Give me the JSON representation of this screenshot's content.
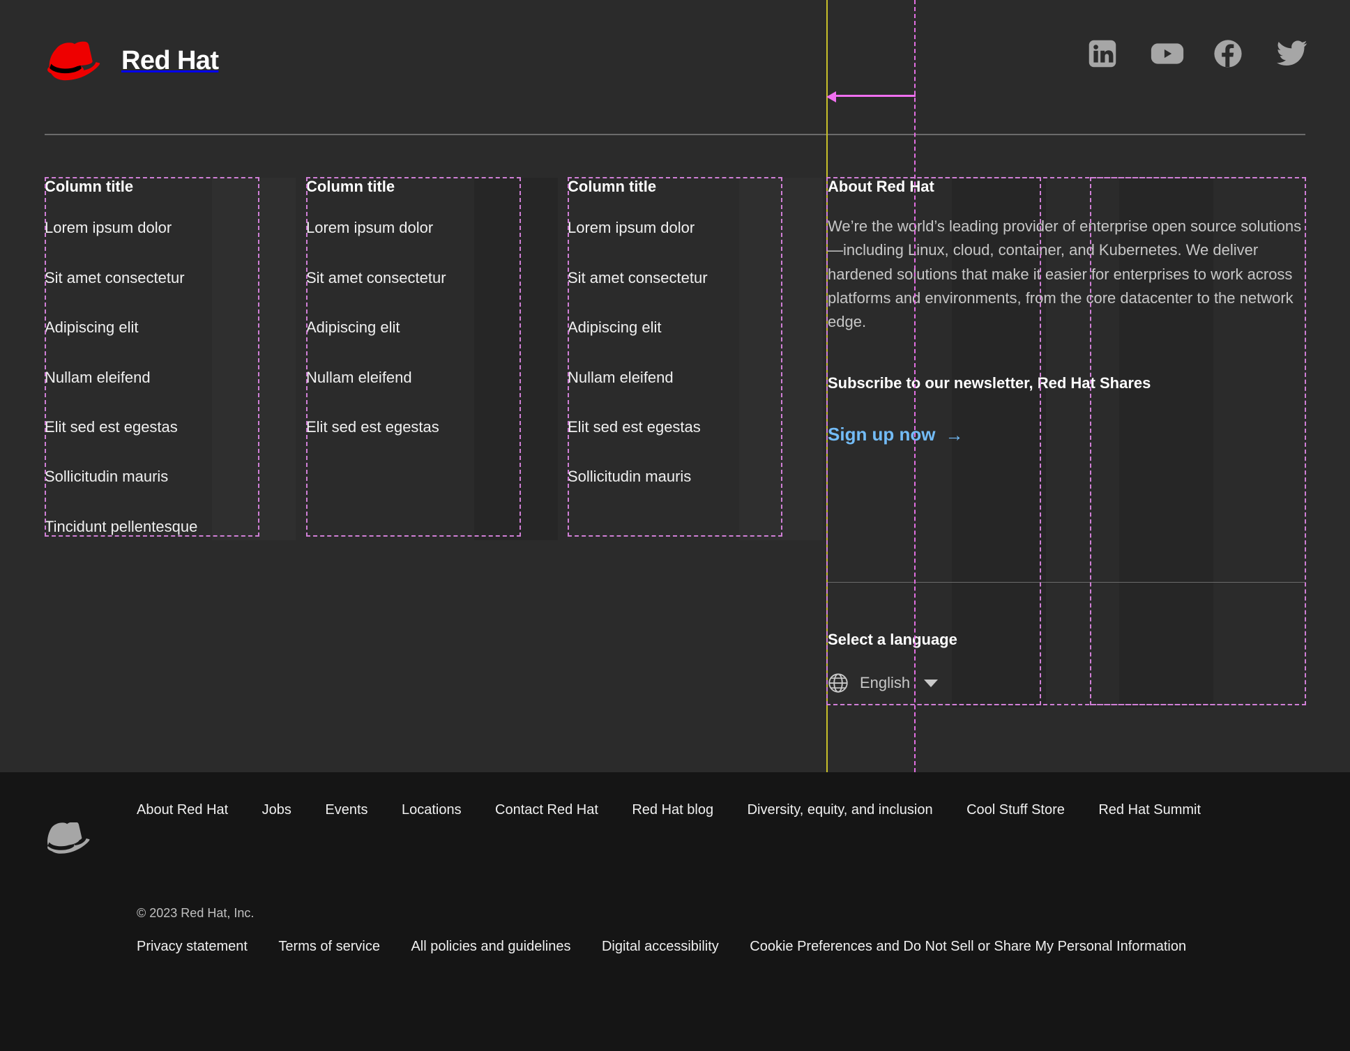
{
  "brand": {
    "name": "Red Hat",
    "logo_icon": "red-hat-fedora-logo"
  },
  "social": [
    {
      "name": "linkedin-icon",
      "label": "LinkedIn"
    },
    {
      "name": "youtube-icon",
      "label": "YouTube"
    },
    {
      "name": "facebook-icon",
      "label": "Facebook"
    },
    {
      "name": "twitter-icon",
      "label": "Twitter"
    }
  ],
  "columns": [
    {
      "title": "Column title",
      "links": [
        "Lorem ipsum dolor",
        "Sit amet consectetur",
        "Adipiscing elit",
        "Nullam eleifend",
        "Elit sed est egestas",
        "Sollicitudin mauris",
        "Tincidunt pellentesque"
      ]
    },
    {
      "title": "Column title",
      "links": [
        "Lorem ipsum dolor",
        "Sit amet consectetur",
        "Adipiscing elit",
        "Nullam eleifend",
        "Elit sed est egestas"
      ]
    },
    {
      "title": "Column title",
      "links": [
        "Lorem ipsum dolor",
        "Sit amet consectetur",
        "Adipiscing elit",
        "Nullam eleifend",
        "Elit sed est egestas",
        "Sollicitudin mauris"
      ]
    }
  ],
  "about": {
    "title": "About Red Hat",
    "body": "We’re the world’s leading provider of enterprise open source solutions—including Linux, cloud, container, and Kubernetes. We deliver hardened solutions that make it easier for enterprises to work across platforms and environments, from the core datacenter to the network edge.",
    "newsletter_title": "Subscribe to our newsletter, Red Hat Shares",
    "signup_label": "Sign up now",
    "signup_arrow": "→",
    "signup_color": "#73bcf7"
  },
  "language": {
    "title": "Select a language",
    "globe_icon": "globe-icon",
    "selected": "English",
    "caret_icon": "chevron-down-icon"
  },
  "footer": {
    "logo_icon": "red-hat-fedora-gray-icon",
    "nav": [
      "About Red Hat",
      "Jobs",
      "Events",
      "Locations",
      "Contact Red Hat",
      "Red Hat blog",
      "Diversity, equity, and inclusion",
      "Cool Stuff Store",
      "Red Hat Summit"
    ],
    "copyright": "© 2023 Red Hat, Inc.",
    "legal": [
      "Privacy statement",
      "Terms of service",
      "All policies and guidelines",
      "Digital accessibility",
      "Cookie Preferences and Do Not Sell or Share My Personal Information"
    ]
  },
  "theme": {
    "upper_bg": "#2b2b2b",
    "lower_bg": "#151515",
    "divider": "#6b6b6b",
    "guide_magenta": "#d07fd6",
    "guide_yellow": "#c8c02a",
    "brand_red": "#ee0000"
  }
}
